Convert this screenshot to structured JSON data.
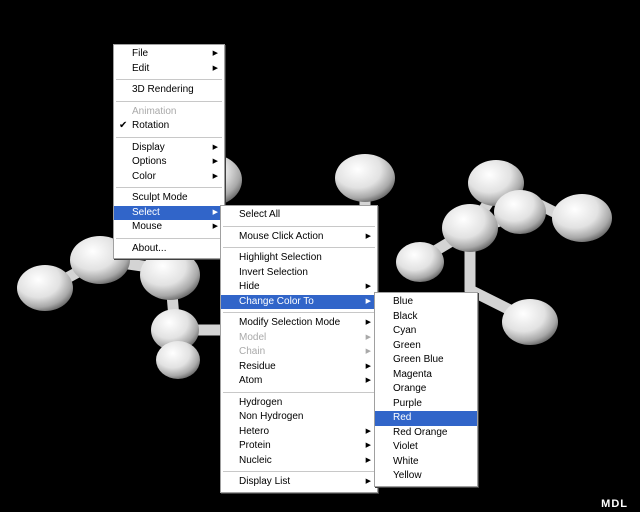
{
  "molecule": {
    "description_icon": "ball-and-stick-molecule",
    "atom_color": "#e8e8e8",
    "background": "#000000"
  },
  "main_menu": {
    "items": [
      {
        "label": "File",
        "arrow": true
      },
      {
        "label": "Edit",
        "arrow": true
      },
      {
        "sep": true
      },
      {
        "label": "3D Rendering"
      },
      {
        "sep": true
      },
      {
        "label": "Animation",
        "disabled": true
      },
      {
        "label": "Rotation",
        "checked": true
      },
      {
        "sep": true
      },
      {
        "label": "Display",
        "arrow": true
      },
      {
        "label": "Options",
        "arrow": true
      },
      {
        "label": "Color",
        "arrow": true
      },
      {
        "sep": true
      },
      {
        "label": "Sculpt Mode"
      },
      {
        "label": "Select",
        "arrow": true,
        "selected": true
      },
      {
        "label": "Mouse",
        "arrow": true
      },
      {
        "sep": true
      },
      {
        "label": "About..."
      }
    ]
  },
  "select_menu": {
    "items": [
      {
        "label": "Select All"
      },
      {
        "sep": true
      },
      {
        "label": "Mouse Click Action",
        "arrow": true
      },
      {
        "sep": true
      },
      {
        "label": "Highlight Selection"
      },
      {
        "label": "Invert Selection"
      },
      {
        "label": "Hide",
        "arrow": true
      },
      {
        "label": "Change Color To",
        "arrow": true,
        "selected": true
      },
      {
        "sep": true
      },
      {
        "label": "Modify Selection Mode",
        "arrow": true
      },
      {
        "label": "Model",
        "arrow": true,
        "disabled": true
      },
      {
        "label": "Chain",
        "arrow": true,
        "disabled": true
      },
      {
        "label": "Residue",
        "arrow": true
      },
      {
        "label": "Atom",
        "arrow": true
      },
      {
        "sep": true
      },
      {
        "label": "Hydrogen"
      },
      {
        "label": "Non Hydrogen"
      },
      {
        "label": "Hetero",
        "arrow": true
      },
      {
        "label": "Protein",
        "arrow": true
      },
      {
        "label": "Nucleic",
        "arrow": true
      },
      {
        "sep": true
      },
      {
        "label": "Display List",
        "arrow": true
      }
    ]
  },
  "color_menu": {
    "items": [
      {
        "label": "Blue"
      },
      {
        "label": "Black"
      },
      {
        "label": "Cyan"
      },
      {
        "label": "Green"
      },
      {
        "label": "Green Blue"
      },
      {
        "label": "Magenta"
      },
      {
        "label": "Orange"
      },
      {
        "label": "Purple"
      },
      {
        "label": "Red",
        "selected": true
      },
      {
        "label": "Red Orange"
      },
      {
        "label": "Violet"
      },
      {
        "label": "White"
      },
      {
        "label": "Yellow"
      }
    ]
  },
  "brand": "MDL"
}
